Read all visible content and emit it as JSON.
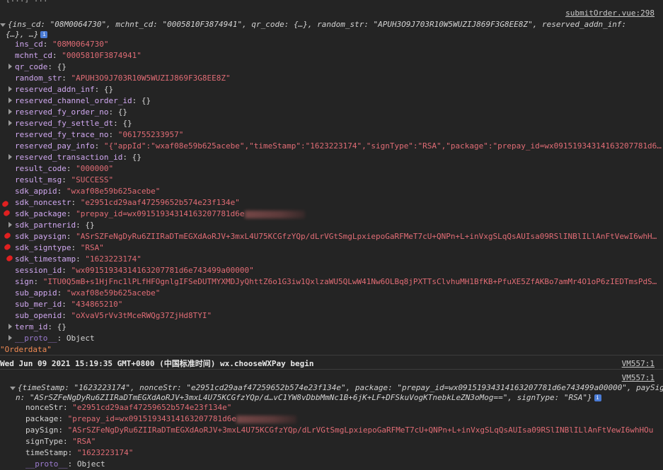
{
  "header_partial": "[...] ...",
  "log1": {
    "source": "submitOrder.vue:298",
    "preview_line1": "{ins_cd: \"08M0064730\", mchnt_cd: \"0005810F3874941\", qr_code: {…}, random_str: \"APUH3O9J703R10W5WUZIJ869F3G8EE8Z\", reserved_addn_inf:",
    "preview_line2": "{…}, …}",
    "props": [
      {
        "key": "ins_cd",
        "value": "\"08M0064730\"",
        "type": "str",
        "expand": false
      },
      {
        "key": "mchnt_cd",
        "value": "\"0005810F3874941\"",
        "type": "str",
        "expand": false
      },
      {
        "key": "qr_code",
        "value": "{}",
        "type": "obj",
        "expand": true
      },
      {
        "key": "random_str",
        "value": "\"APUH3O9J703R10W5WUZIJ869F3G8EE8Z\"",
        "type": "str",
        "expand": false
      },
      {
        "key": "reserved_addn_inf",
        "value": "{}",
        "type": "obj",
        "expand": true
      },
      {
        "key": "reserved_channel_order_id",
        "value": "{}",
        "type": "obj",
        "expand": true
      },
      {
        "key": "reserved_fy_order_no",
        "value": "{}",
        "type": "obj",
        "expand": true
      },
      {
        "key": "reserved_fy_settle_dt",
        "value": "{}",
        "type": "obj",
        "expand": true
      },
      {
        "key": "reserved_fy_trace_no",
        "value": "\"061755233957\"",
        "type": "str",
        "expand": false
      },
      {
        "key": "reserved_pay_info",
        "value": "\"{\"appId\":\"wxaf08e59b625acebe\",\"timeStamp\":\"1623223174\",\"signType\":\"RSA\",\"package\":\"prepay_id=wx09151934314163207781d6…",
        "type": "str",
        "expand": false
      },
      {
        "key": "reserved_transaction_id",
        "value": "{}",
        "type": "obj",
        "expand": true
      },
      {
        "key": "result_code",
        "value": "\"000000\"",
        "type": "str",
        "expand": false
      },
      {
        "key": "result_msg",
        "value": "\"SUCCESS\"",
        "type": "str",
        "expand": false
      },
      {
        "key": "sdk_appid",
        "value": "\"wxaf08e59b625acebe\"",
        "type": "str",
        "expand": false
      },
      {
        "key": "sdk_noncestr",
        "value": "\"e2951cd29aaf47259652b574e23f134e\"",
        "type": "str",
        "expand": false
      },
      {
        "key": "sdk_package",
        "value": "\"prepay_id=wx09151934314163207781d6e",
        "type": "str",
        "expand": false,
        "blur": true
      },
      {
        "key": "sdk_partnerid",
        "value": "{}",
        "type": "obj",
        "expand": true
      },
      {
        "key": "sdk_paysign",
        "value": "\"ASrSZFeNgDyRu6ZIIRaDTmEGXdAoRJV+3mxL4U75KCGfzYQp/dLrVGtSmgLpxiepoGaRFMeT7cU+QNPn+L+inVxgSLqQsAUIsa09RSlINBlILlAnFtVewI6whH…",
        "type": "str",
        "expand": false
      },
      {
        "key": "sdk_signtype",
        "value": "\"RSA\"",
        "type": "str",
        "expand": false
      },
      {
        "key": "sdk_timestamp",
        "value": "\"1623223174\"",
        "type": "str",
        "expand": false
      },
      {
        "key": "session_id",
        "value": "\"wx09151934314163207781d6e743499a00000\"",
        "type": "str",
        "expand": false
      },
      {
        "key": "sign",
        "value": "\"ITU0Q5mB+s1HjFnc1lPLfHFOgnlgIFSeDUTMYXMDJyQhttZ6o1G3iw1QxlzaWU5QLwW41Nw6OLBq8jPXTTsClvhuMH1BfKB+PfuXE5ZfAKBo7amMr4O1oP6zIEDTmsPdS…",
        "type": "str",
        "expand": false
      },
      {
        "key": "sub_appid",
        "value": "\"wxaf08e59b625acebe\"",
        "type": "str",
        "expand": false
      },
      {
        "key": "sub_mer_id",
        "value": "\"434865210\"",
        "type": "str",
        "expand": false
      },
      {
        "key": "sub_openid",
        "value": "\"oXvaV5rVv3tMceRWQg37ZjHd8TYI\"",
        "type": "str",
        "expand": false
      },
      {
        "key": "term_id",
        "value": "{}",
        "type": "obj",
        "expand": true
      },
      {
        "key": "__proto__",
        "value": "Object",
        "type": "proto",
        "expand": true
      }
    ]
  },
  "orderdata_line": "\"Orderdata\"",
  "log2": {
    "text": "Wed Jun 09 2021 15:19:35 GMT+0800 (中国标准时间) wx.chooseWXPay begin",
    "source": "VM557:1"
  },
  "log3": {
    "source": "VM557:1",
    "preview_line1": "{timeStamp: \"1623223174\", nonceStr: \"e2951cd29aaf47259652b574e23f134e\", package: \"prepay_id=wx09151934314163207781d6e743499a00000\", paySig",
    "preview_line2": "n: \"ASrSZFeNgDyRu6ZIIRaDTmEGXdAoRJV+3mxL4U75KCGfzYQp/d…vC1YW8vDbbMmNc1B+6jK+LF+DFSkuVogKTnebkLeZN3oMog==\", signType: \"RSA\"}",
    "props": [
      {
        "key": "nonceStr",
        "value": "\"e2951cd29aaf47259652b574e23f134e\""
      },
      {
        "key": "package",
        "value": "\"prepay_id=wx09151934314163207781d6e",
        "blur": true
      },
      {
        "key": "paySign",
        "value": "\"ASrSZFeNgDyRu6ZIIRaDTmEGXdAoRJV+3mxL4U75KCGfzYQp/dLrVGtSmgLpxiepoGaRFMeT7cU+QNPn+L+inVxgSLqQsAUIsa09RSlINBlILlAnFtVewI6whHOu"
      },
      {
        "key": "signType",
        "value": "\"RSA\""
      },
      {
        "key": "timeStamp",
        "value": "\"1623223174\""
      },
      {
        "key": "__proto__",
        "value": "Object",
        "proto": true
      }
    ]
  }
}
